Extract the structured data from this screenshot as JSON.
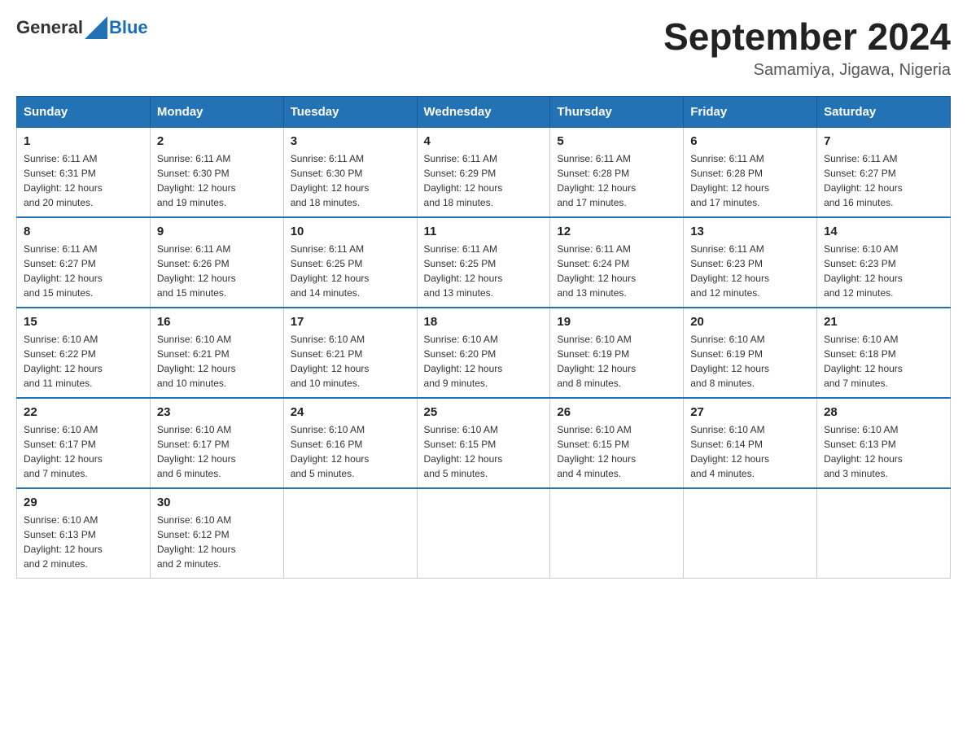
{
  "header": {
    "logo_general": "General",
    "logo_blue": "Blue",
    "title": "September 2024",
    "subtitle": "Samamiya, Jigawa, Nigeria"
  },
  "days_header": [
    "Sunday",
    "Monday",
    "Tuesday",
    "Wednesday",
    "Thursday",
    "Friday",
    "Saturday"
  ],
  "weeks": [
    [
      {
        "day": "1",
        "sunrise": "6:11 AM",
        "sunset": "6:31 PM",
        "daylight": "12 hours and 20 minutes."
      },
      {
        "day": "2",
        "sunrise": "6:11 AM",
        "sunset": "6:30 PM",
        "daylight": "12 hours and 19 minutes."
      },
      {
        "day": "3",
        "sunrise": "6:11 AM",
        "sunset": "6:30 PM",
        "daylight": "12 hours and 18 minutes."
      },
      {
        "day": "4",
        "sunrise": "6:11 AM",
        "sunset": "6:29 PM",
        "daylight": "12 hours and 18 minutes."
      },
      {
        "day": "5",
        "sunrise": "6:11 AM",
        "sunset": "6:28 PM",
        "daylight": "12 hours and 17 minutes."
      },
      {
        "day": "6",
        "sunrise": "6:11 AM",
        "sunset": "6:28 PM",
        "daylight": "12 hours and 17 minutes."
      },
      {
        "day": "7",
        "sunrise": "6:11 AM",
        "sunset": "6:27 PM",
        "daylight": "12 hours and 16 minutes."
      }
    ],
    [
      {
        "day": "8",
        "sunrise": "6:11 AM",
        "sunset": "6:27 PM",
        "daylight": "12 hours and 15 minutes."
      },
      {
        "day": "9",
        "sunrise": "6:11 AM",
        "sunset": "6:26 PM",
        "daylight": "12 hours and 15 minutes."
      },
      {
        "day": "10",
        "sunrise": "6:11 AM",
        "sunset": "6:25 PM",
        "daylight": "12 hours and 14 minutes."
      },
      {
        "day": "11",
        "sunrise": "6:11 AM",
        "sunset": "6:25 PM",
        "daylight": "12 hours and 13 minutes."
      },
      {
        "day": "12",
        "sunrise": "6:11 AM",
        "sunset": "6:24 PM",
        "daylight": "12 hours and 13 minutes."
      },
      {
        "day": "13",
        "sunrise": "6:11 AM",
        "sunset": "6:23 PM",
        "daylight": "12 hours and 12 minutes."
      },
      {
        "day": "14",
        "sunrise": "6:10 AM",
        "sunset": "6:23 PM",
        "daylight": "12 hours and 12 minutes."
      }
    ],
    [
      {
        "day": "15",
        "sunrise": "6:10 AM",
        "sunset": "6:22 PM",
        "daylight": "12 hours and 11 minutes."
      },
      {
        "day": "16",
        "sunrise": "6:10 AM",
        "sunset": "6:21 PM",
        "daylight": "12 hours and 10 minutes."
      },
      {
        "day": "17",
        "sunrise": "6:10 AM",
        "sunset": "6:21 PM",
        "daylight": "12 hours and 10 minutes."
      },
      {
        "day": "18",
        "sunrise": "6:10 AM",
        "sunset": "6:20 PM",
        "daylight": "12 hours and 9 minutes."
      },
      {
        "day": "19",
        "sunrise": "6:10 AM",
        "sunset": "6:19 PM",
        "daylight": "12 hours and 8 minutes."
      },
      {
        "day": "20",
        "sunrise": "6:10 AM",
        "sunset": "6:19 PM",
        "daylight": "12 hours and 8 minutes."
      },
      {
        "day": "21",
        "sunrise": "6:10 AM",
        "sunset": "6:18 PM",
        "daylight": "12 hours and 7 minutes."
      }
    ],
    [
      {
        "day": "22",
        "sunrise": "6:10 AM",
        "sunset": "6:17 PM",
        "daylight": "12 hours and 7 minutes."
      },
      {
        "day": "23",
        "sunrise": "6:10 AM",
        "sunset": "6:17 PM",
        "daylight": "12 hours and 6 minutes."
      },
      {
        "day": "24",
        "sunrise": "6:10 AM",
        "sunset": "6:16 PM",
        "daylight": "12 hours and 5 minutes."
      },
      {
        "day": "25",
        "sunrise": "6:10 AM",
        "sunset": "6:15 PM",
        "daylight": "12 hours and 5 minutes."
      },
      {
        "day": "26",
        "sunrise": "6:10 AM",
        "sunset": "6:15 PM",
        "daylight": "12 hours and 4 minutes."
      },
      {
        "day": "27",
        "sunrise": "6:10 AM",
        "sunset": "6:14 PM",
        "daylight": "12 hours and 4 minutes."
      },
      {
        "day": "28",
        "sunrise": "6:10 AM",
        "sunset": "6:13 PM",
        "daylight": "12 hours and 3 minutes."
      }
    ],
    [
      {
        "day": "29",
        "sunrise": "6:10 AM",
        "sunset": "6:13 PM",
        "daylight": "12 hours and 2 minutes."
      },
      {
        "day": "30",
        "sunrise": "6:10 AM",
        "sunset": "6:12 PM",
        "daylight": "12 hours and 2 minutes."
      },
      null,
      null,
      null,
      null,
      null
    ]
  ],
  "labels": {
    "sunrise": "Sunrise:",
    "sunset": "Sunset:",
    "daylight": "Daylight:"
  }
}
